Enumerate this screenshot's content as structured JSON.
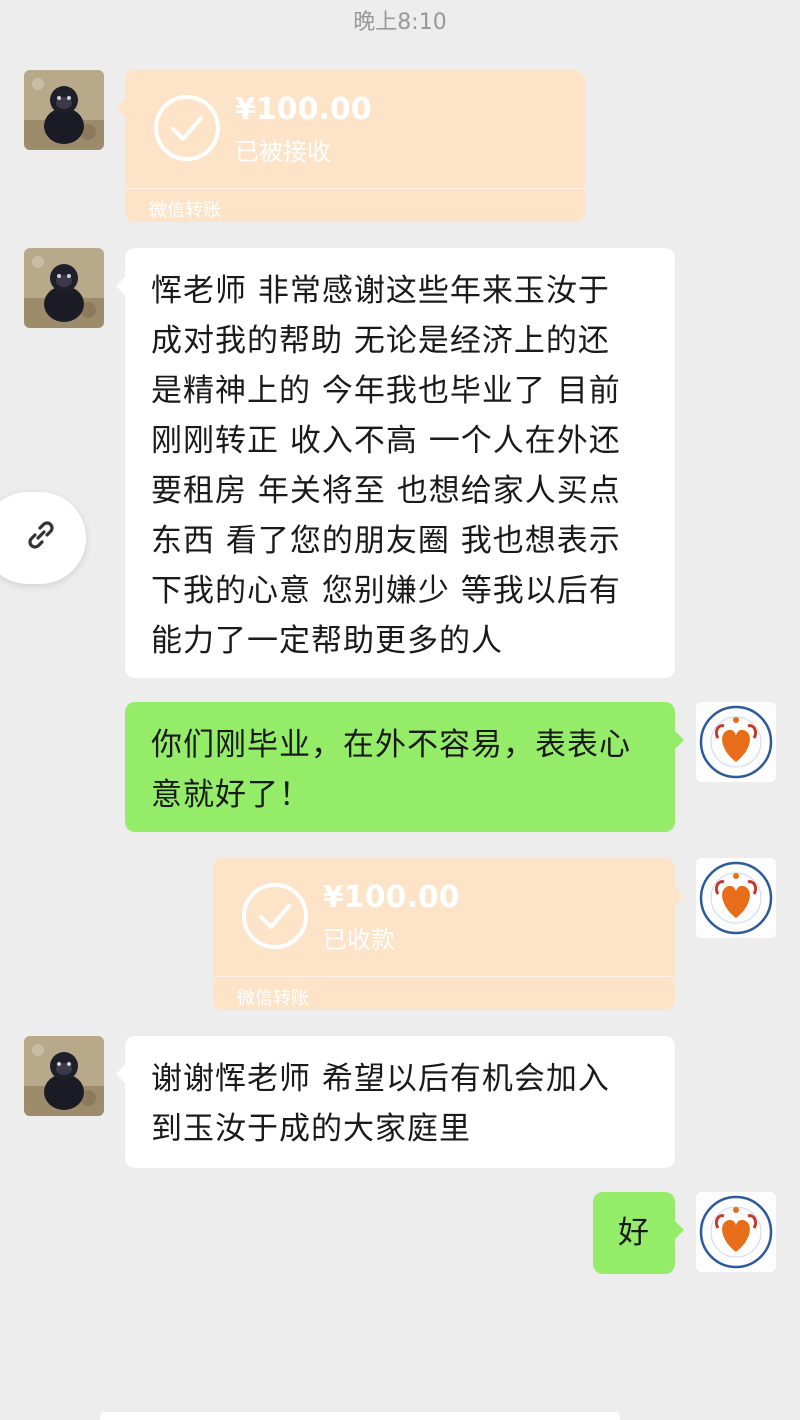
{
  "timestamp": "晚上8:10",
  "messages": [
    {
      "type": "transfer",
      "side": "left",
      "amount": "¥100.00",
      "status": "已被接收",
      "label": "微信转账"
    },
    {
      "type": "text",
      "side": "left",
      "lines": [
        "恽老师 非常感谢这些年来玉汝于",
        "成对我的帮助 无论是经济上的还",
        "是精神上的 今年我也毕业了 目前",
        "刚刚转正 收入不高 一个人在外还",
        "要租房 年关将至 也想给家人买点",
        "东西 看了您的朋友圈 我也想表示",
        "下我的心意 您别嫌少 等我以后有",
        "能力了一定帮助更多的人"
      ]
    },
    {
      "type": "text",
      "side": "right",
      "lines": [
        "你们刚毕业，在外不容易，表表心",
        "意就好了！"
      ]
    },
    {
      "type": "transfer",
      "side": "right",
      "amount": "¥100.00",
      "status": "已收款",
      "label": "微信转账"
    },
    {
      "type": "text",
      "side": "left",
      "lines": [
        "谢谢恽老师 希望以后有机会加入",
        "到玉汝于成的大家庭里"
      ]
    },
    {
      "type": "text",
      "side": "right",
      "lines": [
        "好"
      ]
    }
  ],
  "icons": {
    "transfer": "check-circle-icon",
    "floating": "link-icon",
    "left_avatar": "gorilla-avatar",
    "right_avatar": "foundation-logo-avatar"
  },
  "colors": {
    "background": "#ededed",
    "bubble_left": "#ffffff",
    "bubble_right": "#95ec69",
    "transfer": "#fde3c7"
  }
}
